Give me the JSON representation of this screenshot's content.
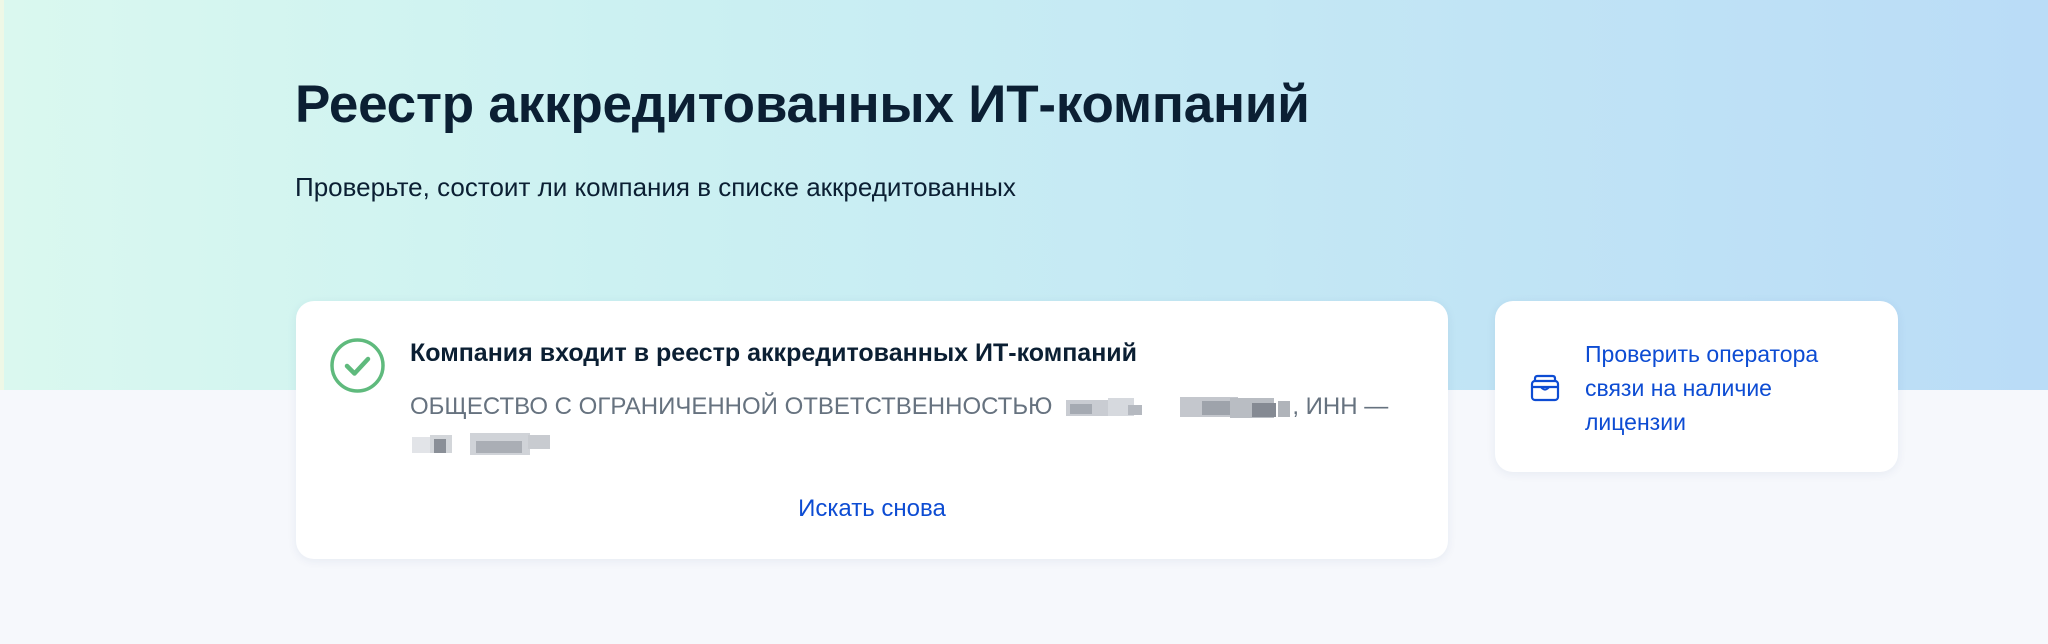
{
  "hero": {
    "title": "Реестр аккредитованных ИТ-компаний",
    "subtitle": "Проверьте, состоит ли компания в списке аккредитованных"
  },
  "result": {
    "status_icon": "check-circle-icon",
    "title": "Компания входит в реестр аккредитованных ИТ-компаний",
    "company_prefix": "ОБЩЕСТВО С ОГРАНИЧЕННОЙ ОТВЕТСТВЕННОСТЬЮ",
    "inn_label": ", ИНН —",
    "search_again_label": "Искать снова"
  },
  "side": {
    "icon": "wallet-icon",
    "link_label": "Проверить оператора связи на наличие лицензии"
  },
  "colors": {
    "accent_link": "#0d4cd3",
    "success": "#5fba7d",
    "heading": "#0b1f33"
  }
}
